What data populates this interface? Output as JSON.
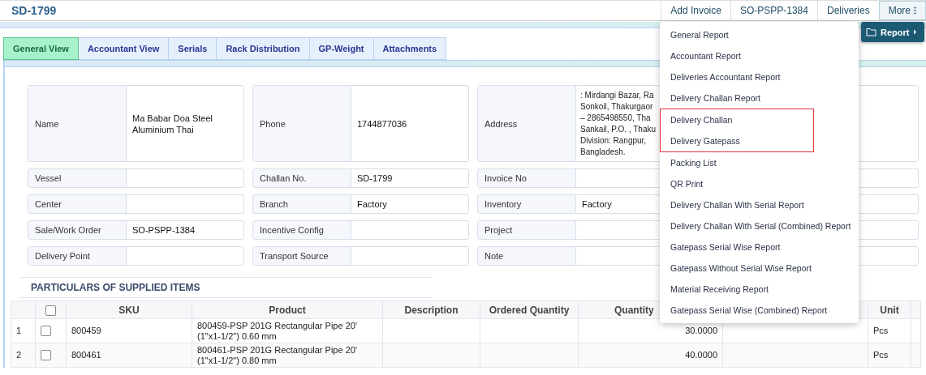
{
  "header": {
    "title": "SD-1799",
    "actions": [
      {
        "label": "Add Invoice",
        "kind": "button"
      },
      {
        "label": "SO-PSPP-1384",
        "kind": "button"
      },
      {
        "label": "Deliveries",
        "kind": "button"
      },
      {
        "label": "More",
        "kind": "more"
      }
    ]
  },
  "tabs": [
    {
      "label": "General View",
      "selected": true
    },
    {
      "label": "Accountant View",
      "selected": false
    },
    {
      "label": "Serials",
      "selected": false
    },
    {
      "label": "Rack Distribution",
      "selected": false
    },
    {
      "label": "GP-Weight",
      "selected": false
    },
    {
      "label": "Attachments",
      "selected": false
    }
  ],
  "fields": [
    [
      {
        "label": "Name",
        "value": "Ma Babar Doa Steel Aluminium Thai"
      },
      {
        "label": "Phone",
        "value": "1744877036"
      },
      {
        "label": "Address",
        "lines": [
          ": Mirdangi Bazar, Ra",
          "Sonkoil, Thakurgaor",
          "– 2865498550, Tha",
          "Sankail, P.O. , Thaku",
          "Division: Rangpur,",
          "Bangladesh."
        ]
      }
    ],
    [
      {
        "label": "Vessel"
      },
      {
        "label": "Challan No.",
        "value": "SD-1799"
      },
      {
        "label": "Invoice No"
      }
    ],
    [
      {
        "label": "Center"
      },
      {
        "label": "Branch",
        "value": "Factory"
      },
      {
        "label": "Inventory",
        "value": "Factory"
      }
    ],
    [
      {
        "label": "Sale/Work Order",
        "value": "SO-PSPP-1384"
      },
      {
        "label": "Incentive Config"
      },
      {
        "label": "Project"
      }
    ],
    [
      {
        "label": "Delivery Point"
      },
      {
        "label": "Transport Source"
      },
      {
        "label": "Note"
      }
    ]
  ],
  "section_title": "PARTICULARS OF SUPPLIED ITEMS",
  "table": {
    "select_all": {
      "checked": false
    },
    "columns": [
      "SKU",
      "Product",
      "Description",
      "Ordered Quantity",
      "Quantity",
      "Unit"
    ],
    "rows": [
      {
        "number": "1",
        "checked": false,
        "sku": "800459",
        "product": "800459-PSP 201G Rectangular Pipe 20' (1\"x1-1/2\") 0.60 mm",
        "quantity": "30.0000",
        "unit": "Pcs"
      },
      {
        "number": "2",
        "checked": false,
        "sku": "800461",
        "product": "800461-PSP 201G Rectangular Pipe 20' (1\"x1-1/2\") 0.80 mm",
        "quantity": "40.0000",
        "unit": "Pcs"
      }
    ]
  },
  "report_menu": {
    "button": "Report",
    "items": [
      {
        "label": "General Report",
        "highlighted": false
      },
      {
        "label": "Accountant Report",
        "highlighted": false
      },
      {
        "label": "Deliveries Accountant Report",
        "highlighted": false
      },
      {
        "label": "Delivery Challan Report",
        "highlighted": false
      },
      {
        "label": "Delivery Challan",
        "highlighted": true
      },
      {
        "label": "Delivery Gatepass",
        "highlighted": true
      },
      {
        "label": "Packing List",
        "highlighted": false
      },
      {
        "label": "QR Print",
        "highlighted": false
      },
      {
        "label": "Delivery Challan With Serial Report",
        "highlighted": false
      },
      {
        "label": "Delivery Challan With Serial (Combined) Report",
        "highlighted": false
      },
      {
        "label": "Gatepass Serial Wise Report",
        "highlighted": false
      },
      {
        "label": "Gatepass Without Serial Wise Report",
        "highlighted": false
      },
      {
        "label": "Material Receiving Report",
        "highlighted": false
      },
      {
        "label": "Gatepass Serial Wise (Combined) Report",
        "highlighted": false
      }
    ]
  }
}
